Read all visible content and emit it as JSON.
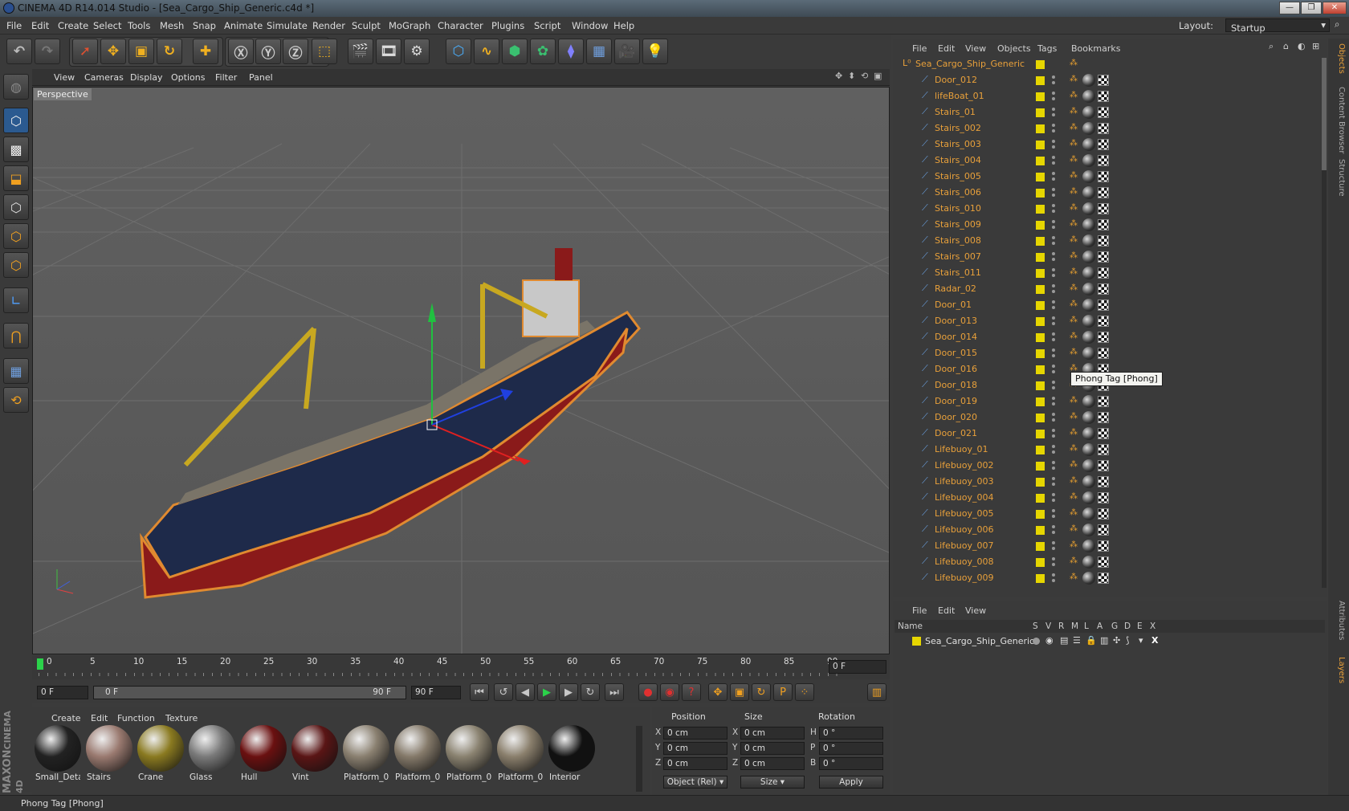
{
  "window": {
    "title": "CINEMA 4D R14.014 Studio - [Sea_Cargo_Ship_Generic.c4d *]"
  },
  "menu": [
    "File",
    "Edit",
    "Create",
    "Select",
    "Tools",
    "Mesh",
    "Snap",
    "Animate",
    "Simulate",
    "Render",
    "Sculpt",
    "MoGraph",
    "Character",
    "Plugins",
    "Script",
    "Window",
    "Help"
  ],
  "layout": {
    "label": "Layout:",
    "value": "Startup"
  },
  "viewport": {
    "menu": [
      "View",
      "Cameras",
      "Display",
      "Options",
      "Filter",
      "Panel"
    ],
    "label": "Perspective"
  },
  "timeline": {
    "ticks": [
      "0",
      "5",
      "10",
      "15",
      "20",
      "25",
      "30",
      "35",
      "40",
      "45",
      "50",
      "55",
      "60",
      "65",
      "70",
      "75",
      "80",
      "85",
      "90"
    ],
    "current_frame": "0 F",
    "start_frame": "0 F",
    "range_start": "0 F",
    "range_end": "90 F",
    "end_frame": "90 F"
  },
  "material_manager": {
    "menu": [
      "Create",
      "Edit",
      "Function",
      "Texture"
    ],
    "materials": [
      {
        "name": "Small_Deta",
        "color": "#222222"
      },
      {
        "name": "Stairs",
        "color": "#9a7a70"
      },
      {
        "name": "Crane",
        "color": "#8a7a20"
      },
      {
        "name": "Glass",
        "color": "#7a7a7a"
      },
      {
        "name": "Hull",
        "color": "#6a1010"
      },
      {
        "name": "Vint",
        "color": "#5a1515"
      },
      {
        "name": "Platform_0:",
        "color": "#8a8070"
      },
      {
        "name": "Platform_0?",
        "color": "#857a6a"
      },
      {
        "name": "Platform_0:",
        "color": "#8a8270"
      },
      {
        "name": "Platform_0l",
        "color": "#8a7f6c"
      },
      {
        "name": "Interior",
        "color": "#111111"
      }
    ]
  },
  "coordinates": {
    "headers": [
      "Position",
      "Size",
      "Rotation"
    ],
    "rows": [
      {
        "axis": "X",
        "pos": "0 cm",
        "saxis": "X",
        "size": "0 cm",
        "raxis": "H",
        "rot": "0 °"
      },
      {
        "axis": "Y",
        "pos": "0 cm",
        "saxis": "Y",
        "size": "0 cm",
        "raxis": "P",
        "rot": "0 °"
      },
      {
        "axis": "Z",
        "pos": "0 cm",
        "saxis": "Z",
        "size": "0 cm",
        "raxis": "B",
        "rot": "0 °"
      }
    ],
    "mode": "Object (Rel)",
    "size_mode": "Size",
    "apply": "Apply"
  },
  "object_manager": {
    "menu": [
      "File",
      "Edit",
      "View",
      "Objects",
      "Tags",
      "Bookmarks"
    ],
    "root": "Sea_Cargo_Ship_Generic",
    "objects": [
      "Door_012",
      "lifeBoat_01",
      "Stairs_01",
      "Stairs_002",
      "Stairs_003",
      "Stairs_004",
      "Stairs_005",
      "Stairs_006",
      "Stairs_010",
      "Stairs_009",
      "Stairs_008",
      "Stairs_007",
      "Stairs_011",
      "Radar_02",
      "Door_01",
      "Door_013",
      "Door_014",
      "Door_015",
      "Door_016",
      "Door_018",
      "Door_019",
      "Door_020",
      "Door_021",
      "Lifebuoy_01",
      "Lifebuoy_002",
      "Lifebuoy_003",
      "Lifebuoy_004",
      "Lifebuoy_005",
      "Lifebuoy_006",
      "Lifebuoy_007",
      "Lifebuoy_008",
      "Lifebuoy_009"
    ],
    "tooltip": "Phong Tag [Phong]"
  },
  "layer_manager": {
    "menu": [
      "File",
      "Edit",
      "View"
    ],
    "columns": [
      "Name",
      "S",
      "V",
      "R",
      "M",
      "L",
      "A",
      "G",
      "D",
      "E",
      "X"
    ],
    "layer": "Sea_Cargo_Ship_Generic"
  },
  "side_tabs": [
    "Objects",
    "Content Browser",
    "Structure",
    "Attributes",
    "Layers"
  ],
  "status": "Phong Tag [Phong]",
  "colors": {
    "accent": "#e8a03a",
    "layer": "#e6d600"
  }
}
